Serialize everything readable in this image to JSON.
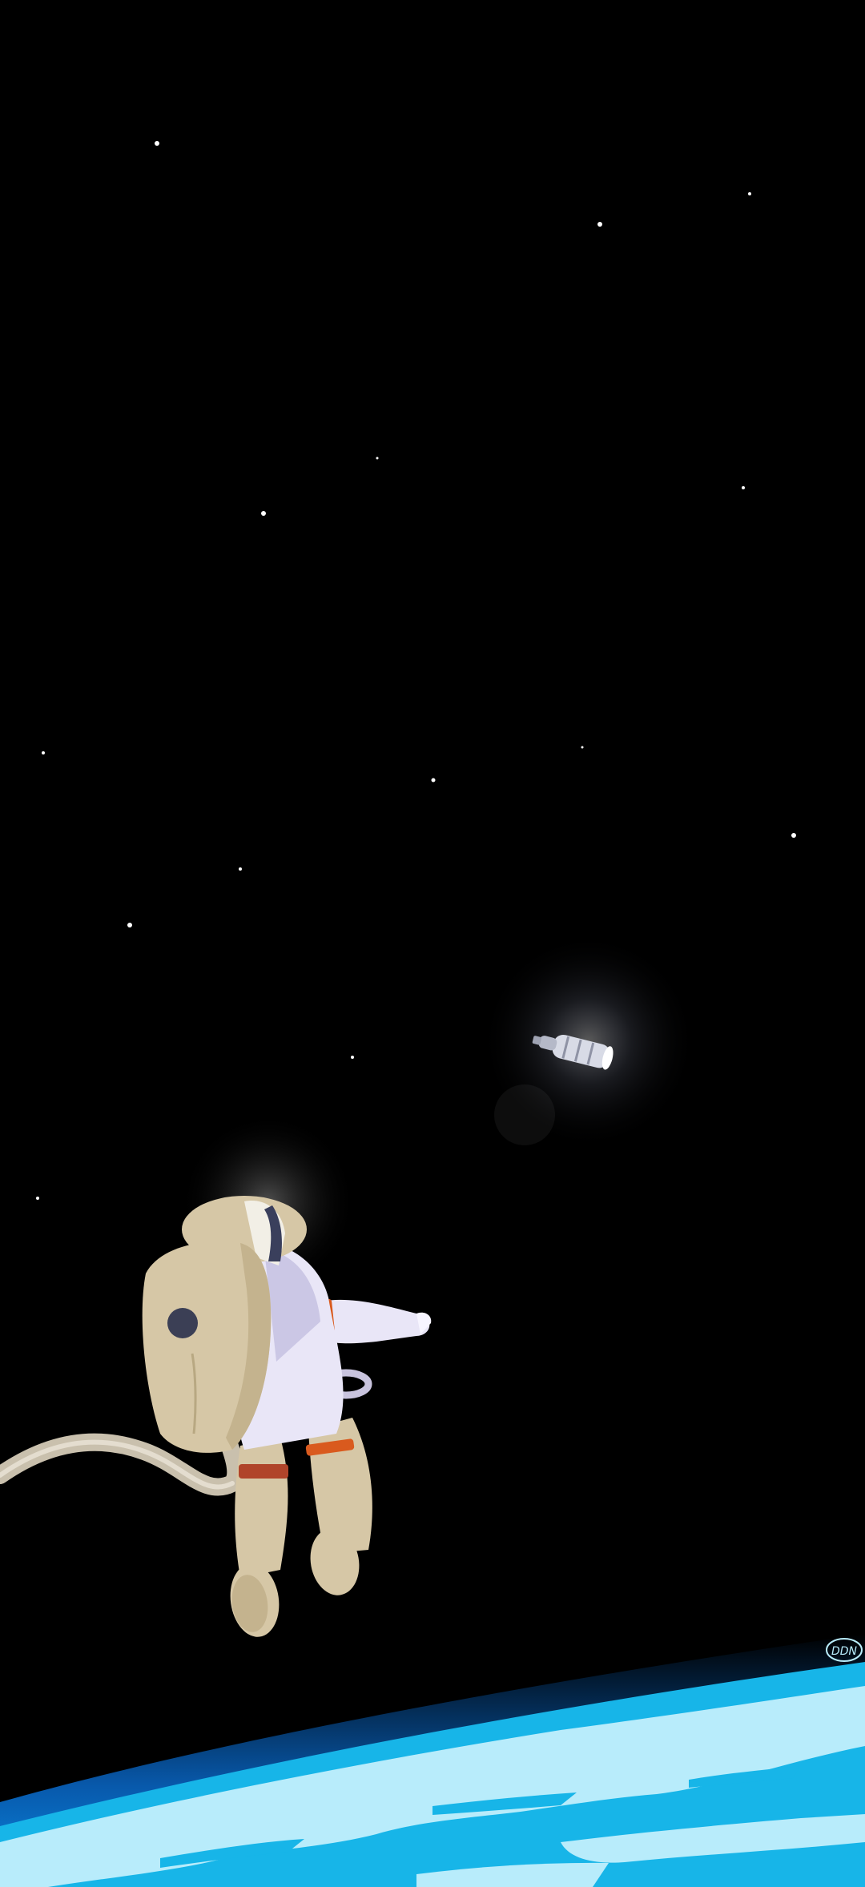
{
  "scene": {
    "background_color": "#000000",
    "earth_colors": {
      "atmosphere": "#0a6fd6",
      "ocean": "#17b5e8",
      "land": "#b8ecfb"
    },
    "suit_colors": {
      "primary": "#e9e6f7",
      "shadow": "#b8b2d8",
      "backpack": "#d6c7a6",
      "stripe": "#d95a1e"
    }
  },
  "signature": {
    "text": "DDN"
  }
}
